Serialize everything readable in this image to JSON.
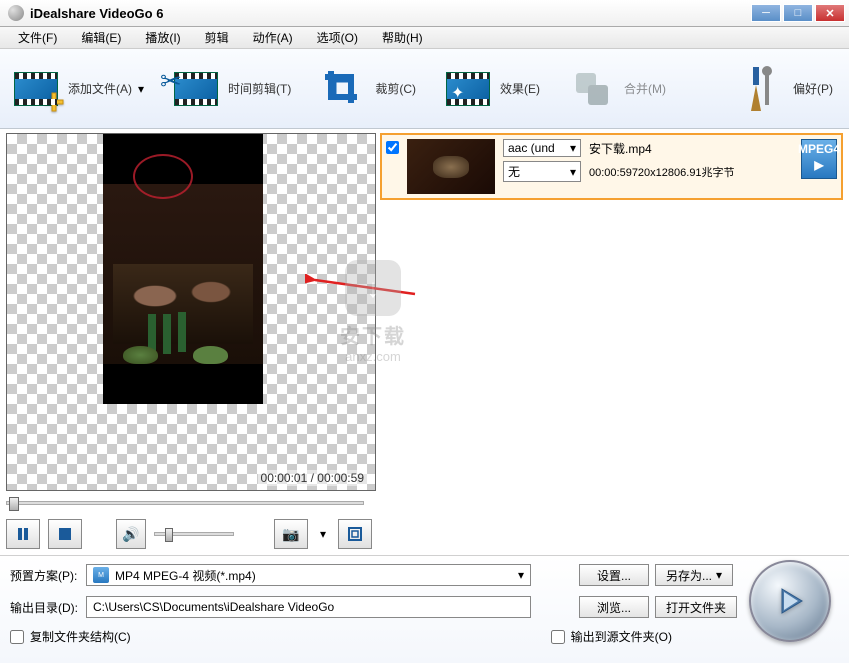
{
  "window": {
    "title": "iDealshare VideoGo 6"
  },
  "menu": {
    "file": "文件(F)",
    "edit": "编辑(E)",
    "play": "播放(I)",
    "trim": "剪辑",
    "action": "动作(A)",
    "options": "选项(O)",
    "help": "帮助(H)"
  },
  "toolbar": {
    "add": "添加文件(A)",
    "time_trim": "时间剪辑(T)",
    "crop": "裁剪(C)",
    "effect": "效果(E)",
    "merge": "合并(M)",
    "pref": "偏好(P)"
  },
  "preview": {
    "time_current": "00:00:01",
    "time_sep": " / ",
    "time_total": "00:00:59"
  },
  "file": {
    "audio_track": "aac (und",
    "name": "安下载.mp4",
    "subtitle": "无",
    "info": "00:00:59720x12806.91兆字节",
    "format_badge": "MPEG4"
  },
  "profile": {
    "label": "预置方案(P):",
    "value": "MP4 MPEG-4 视频(*.mp4)",
    "settings_btn": "设置...",
    "saveas_btn": "另存为..."
  },
  "output": {
    "label": "输出目录(D):",
    "path": "C:\\Users\\CS\\Documents\\iDealshare VideoGo",
    "browse_btn": "浏览...",
    "open_btn": "打开文件夹"
  },
  "checks": {
    "copy_structure": "复制文件夹结构(C)",
    "output_to_source": "输出到源文件夹(O)"
  },
  "watermark": {
    "text": "安下载",
    "url": "anxz.com"
  }
}
